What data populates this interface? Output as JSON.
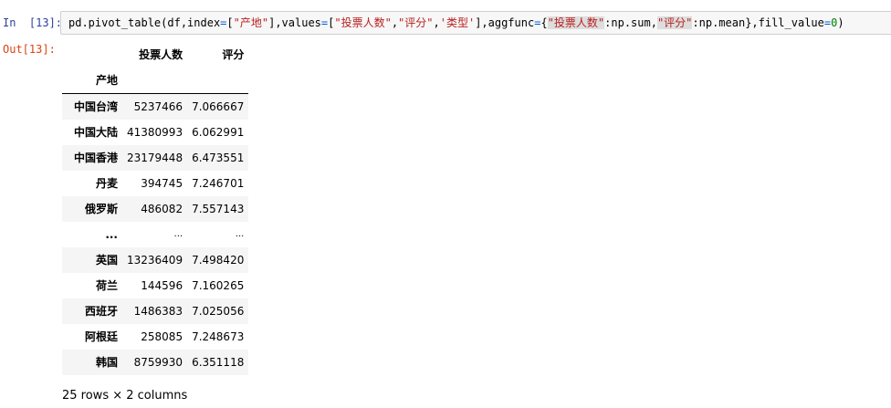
{
  "input_cell": {
    "prompt": "In  [13]:",
    "code": {
      "p1": "pd.pivot_table(df,index",
      "eq1": "=",
      "p2": "[",
      "s1": "\"产地\"",
      "p3": "],values",
      "eq2": "=",
      "p4": "[",
      "s2": "\"投票人数\"",
      "p5": ",",
      "s3": "\"评分\"",
      "p6": ",",
      "s4": "'类型'",
      "p7": "],aggfunc",
      "eq3": "=",
      "p8": "{",
      "s5": "\"投票人数\"",
      "p9": ":np.sum,",
      "s6": "\"评分\"",
      "p10": ":np.mean},fill_value",
      "eq4": "=",
      "n1": "0",
      "p11": ")"
    }
  },
  "output_cell": {
    "prompt": "Out[13]:",
    "table": {
      "columns": [
        "投票人数",
        "评分"
      ],
      "index_name": "产地",
      "rows": [
        {
          "index": "中国台湾",
          "votes": "5237466",
          "score": "7.066667"
        },
        {
          "index": "中国大陆",
          "votes": "41380993",
          "score": "6.062991"
        },
        {
          "index": "中国香港",
          "votes": "23179448",
          "score": "6.473551"
        },
        {
          "index": "丹麦",
          "votes": "394745",
          "score": "7.246701"
        },
        {
          "index": "俄罗斯",
          "votes": "486082",
          "score": "7.557143"
        },
        {
          "index": "...",
          "votes": "...",
          "score": "..."
        },
        {
          "index": "英国",
          "votes": "13236409",
          "score": "7.498420"
        },
        {
          "index": "荷兰",
          "votes": "144596",
          "score": "7.160265"
        },
        {
          "index": "西班牙",
          "votes": "1486383",
          "score": "7.025056"
        },
        {
          "index": "阿根廷",
          "votes": "258085",
          "score": "7.248673"
        },
        {
          "index": "韩国",
          "votes": "8759930",
          "score": "6.351118"
        }
      ]
    },
    "shape_note": "25 rows × 2 columns"
  }
}
